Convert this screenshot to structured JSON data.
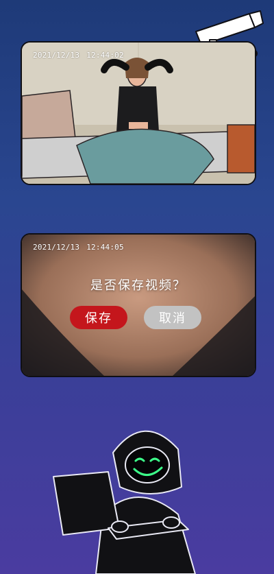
{
  "feed_top": {
    "date": "2021/12/13",
    "time": "12:44:02"
  },
  "feed_bottom": {
    "date": "2021/12/13",
    "time": "12:44:05"
  },
  "dialog": {
    "question": "是否保存视频？",
    "save_label": "保存",
    "cancel_label": "取消"
  },
  "colors": {
    "background_top": "#1e3a78",
    "background_bottom": "#4a3ca0",
    "save_button": "#c4161c",
    "cancel_button": "#c2c2c2",
    "hacker_smile": "#3dff8a"
  },
  "icons": {
    "camera": "security-camera-icon",
    "hacker": "hooded-hacker-illustration"
  }
}
